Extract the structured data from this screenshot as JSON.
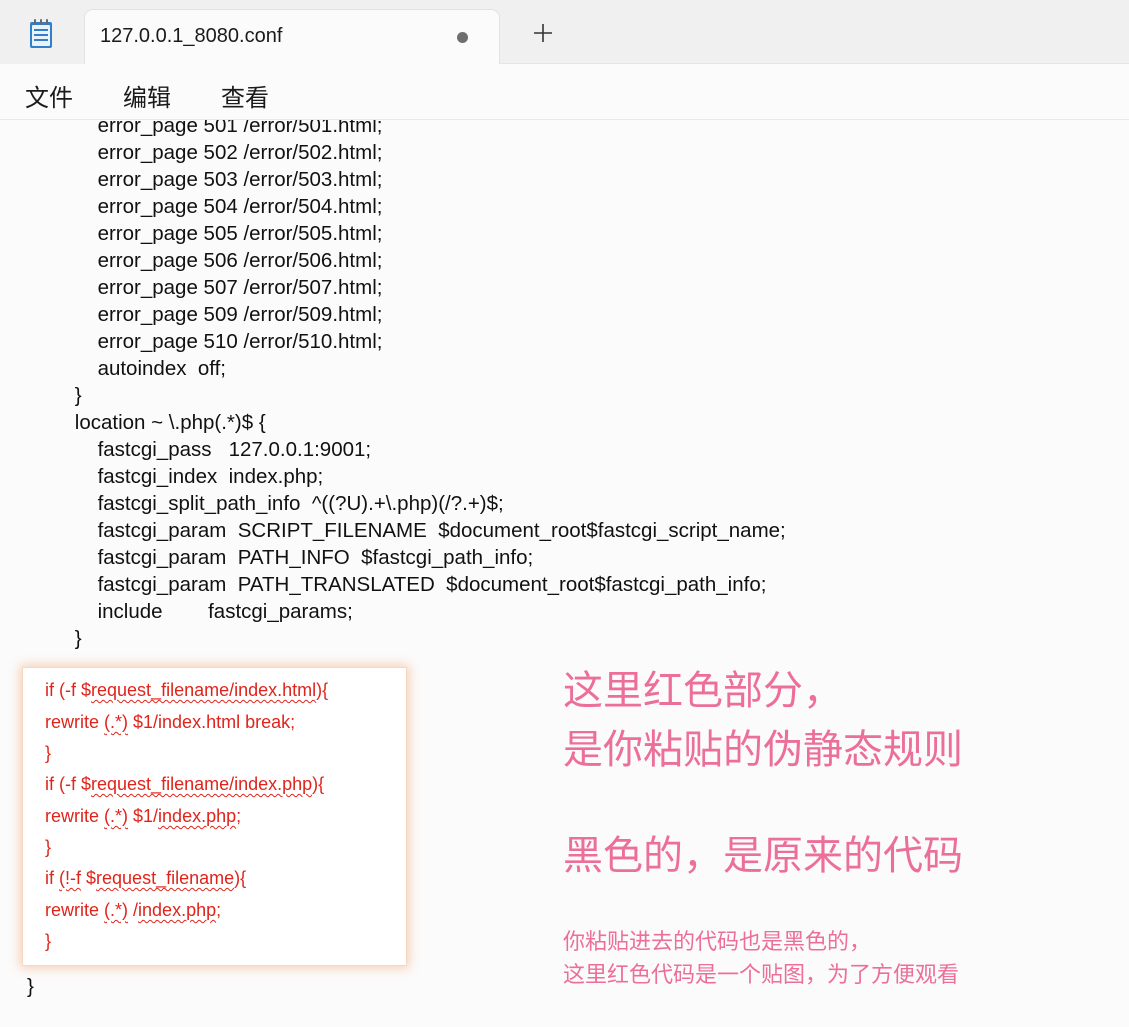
{
  "tab": {
    "title": "127.0.0.1_8080.conf",
    "unsaved_indicator": "unsaved-dot-icon",
    "new_tab_icon": "plus-icon",
    "app_icon": "notepad-icon"
  },
  "menu": {
    "items": [
      "文件",
      "编辑",
      "查看"
    ]
  },
  "editor": {
    "lines": [
      "        error_page 501 /error/501.html;",
      "        error_page 502 /error/502.html;",
      "        error_page 503 /error/503.html;",
      "        error_page 504 /error/504.html;",
      "        error_page 505 /error/505.html;",
      "        error_page 506 /error/506.html;",
      "        error_page 507 /error/507.html;",
      "        error_page 509 /error/509.html;",
      "        error_page 510 /error/510.html;",
      "        autoindex  off;",
      "    }",
      "    location ~ \\.php(.*)$ {",
      "        fastcgi_pass   127.0.0.1:9001;",
      "        fastcgi_index  index.php;",
      "        fastcgi_split_path_info  ^((?U).+\\.php)(/?.+)$;",
      "        fastcgi_param  SCRIPT_FILENAME  $document_root$fastcgi_script_name;",
      "        fastcgi_param  PATH_INFO  $fastcgi_path_info;",
      "        fastcgi_param  PATH_TRANSLATED  $document_root$fastcgi_path_info;",
      "        include        fastcgi_params;",
      "    }"
    ],
    "closing_brace": "}"
  },
  "snippet": {
    "lines": [
      "if (-f $request_filename/index.html){",
      "rewrite (.*) $1/index.html break;",
      "}",
      "if (-f $request_filename/index.php){",
      "rewrite (.*) $1/index.php;",
      "}",
      "if (!-f $request_filename){",
      "rewrite (.*) /index.php;",
      "}"
    ],
    "color": "#e0241b"
  },
  "annotations": {
    "line1": "这里红色部分，",
    "line2": "是你粘贴的伪静态规则",
    "line3": "黑色的，是原来的代码",
    "line4": "你粘贴进去的代码也是黑色的，",
    "line5": "这里红色代码是一个贴图，为了方便观看",
    "color": "#ec6f99"
  }
}
